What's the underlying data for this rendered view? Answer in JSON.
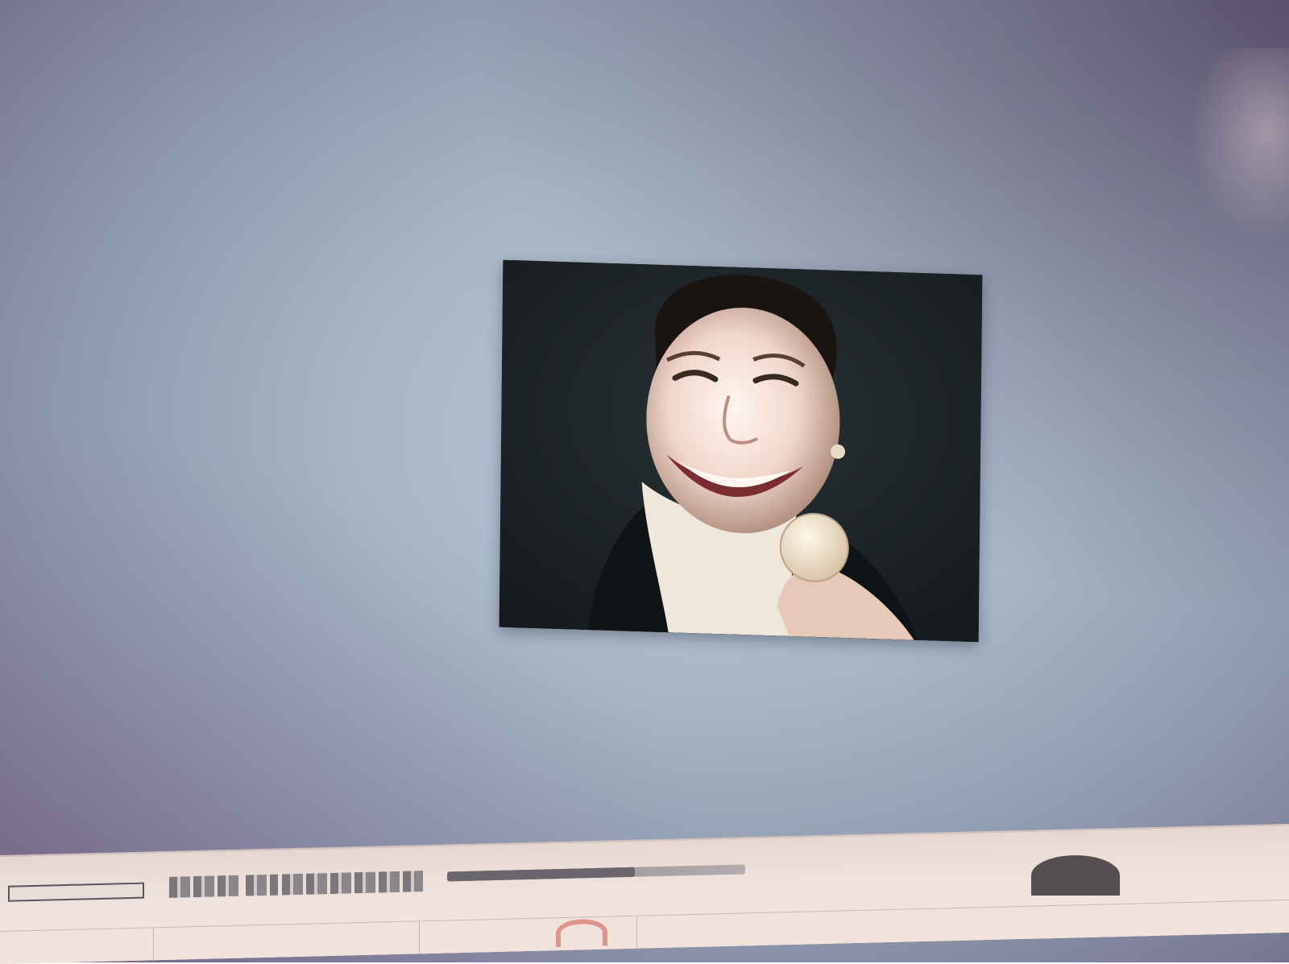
{
  "desktop": {
    "background_color": "#a9b8c8"
  },
  "photo_viewer": {
    "image": "portrait-photo-smiling-woman-holding-coin"
  },
  "taskbar": {
    "items": [
      {
        "icon": "window-thumbnail-icon"
      },
      {
        "icon": "window-thumbnail-icon"
      },
      {
        "icon": "window-thumbnail-icon"
      }
    ],
    "progress": 0.63,
    "tray_icon": "browser-icon"
  }
}
